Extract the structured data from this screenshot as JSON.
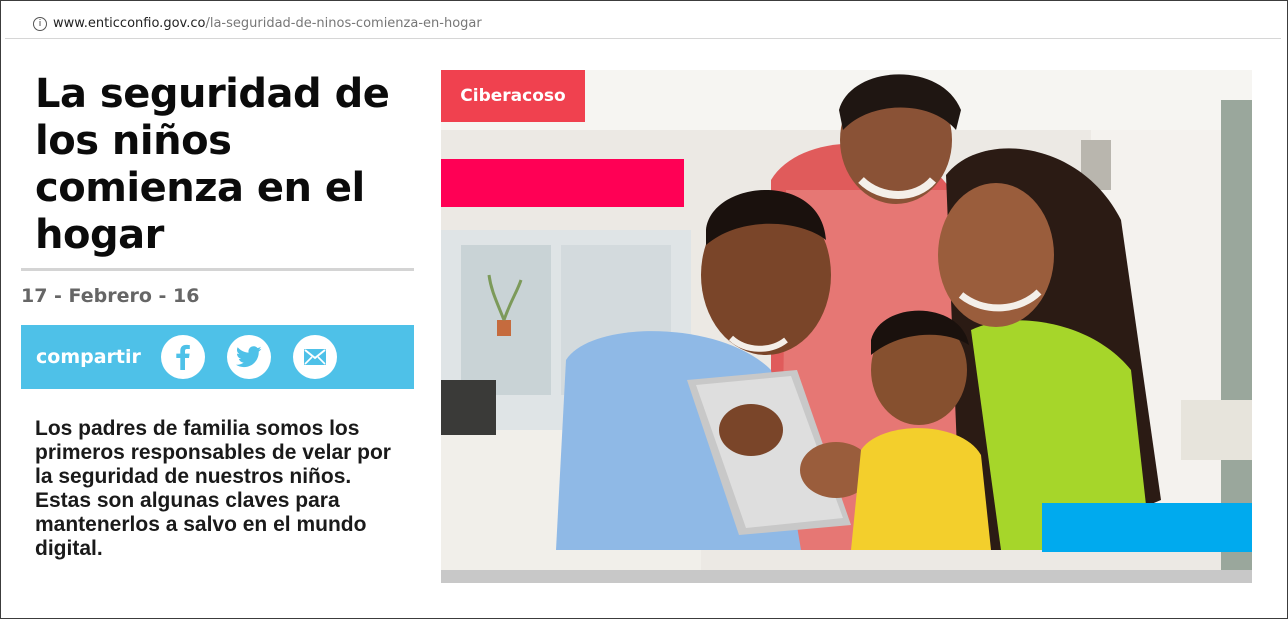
{
  "browser": {
    "url_host": "www.enticconfio.gov.co",
    "url_path": "/la-seguridad-de-ninos-comienza-en-hogar",
    "info_icon": "info-circle-icon"
  },
  "article": {
    "title": "La seguridad de los niños comienza en el hogar",
    "date": "17 - Febrero - 16",
    "share": {
      "label": "compartir",
      "buttons": [
        "facebook-icon",
        "twitter-icon",
        "email-icon"
      ]
    },
    "intro": "Los padres de familia somos los primeros responsables de velar por la seguridad de nuestros niños. Estas son algunas claves para mantenerlos a salvo en el mundo digital.",
    "category_tag": "Ciberacoso"
  },
  "colors": {
    "share_bar": "#4ec1e8",
    "tag": "#f0414f",
    "deco_pink": "#ff0055",
    "deco_blue": "#00aaee"
  }
}
